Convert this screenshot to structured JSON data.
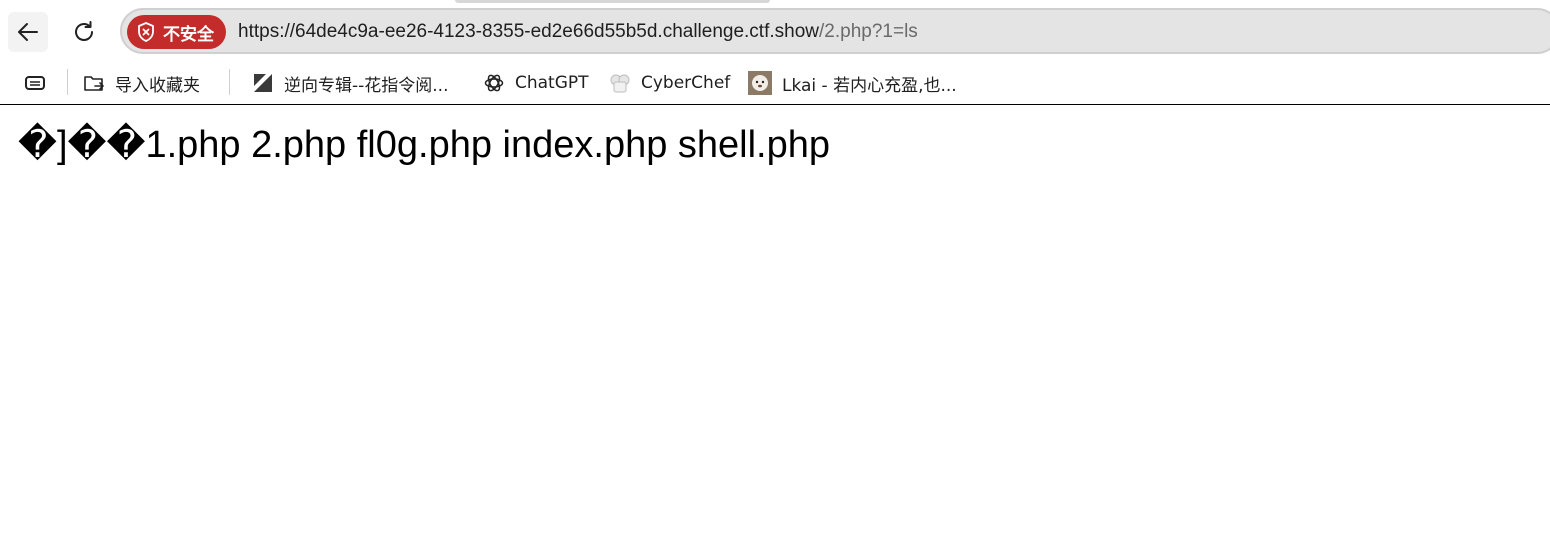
{
  "navigation": {
    "back_icon": "arrow-left-icon",
    "reload_icon": "reload-icon"
  },
  "addressbar": {
    "security_label": "不安全",
    "url_host": "https://64de4c9a-ee26-4123-8355-ed2e66d55b5d.challenge.ctf.show",
    "url_path": "/2.php?1=ls",
    "insecure_color": "#c42b2b"
  },
  "bookmarks": {
    "items": [
      {
        "label": "导入收藏夹",
        "icon": "import-favorites-icon"
      },
      {
        "label": "逆向专辑--花指令阅...",
        "icon": "site-favicon"
      },
      {
        "label": "ChatGPT",
        "icon": "chatgpt-icon"
      },
      {
        "label": "CyberChef",
        "icon": "cyberchef-icon"
      },
      {
        "label": "Lkai - 若内心充盈,也...",
        "icon": "avatar-favicon"
      }
    ]
  },
  "page": {
    "output_text": "�]��1.php 2.php fl0g.php index.php shell.php"
  }
}
